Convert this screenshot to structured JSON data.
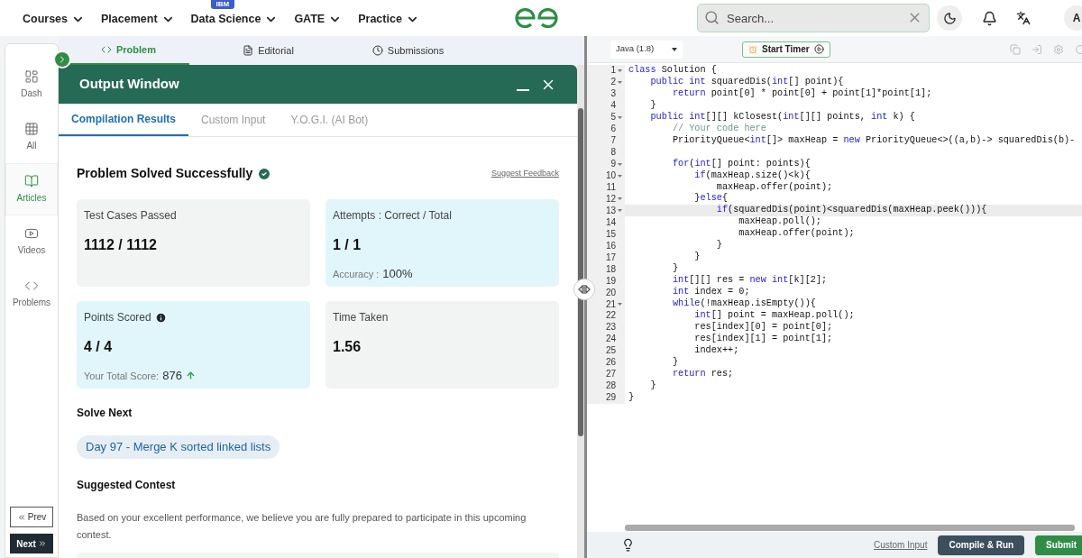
{
  "top_nav": {
    "items": [
      {
        "label": "Courses"
      },
      {
        "label": "Placement"
      },
      {
        "label": "Data Science",
        "badge": "IBM"
      },
      {
        "label": "GATE"
      },
      {
        "label": "Practice"
      }
    ],
    "search": {
      "placeholder": "Search..."
    },
    "avatar": "A"
  },
  "sidebar": {
    "items": [
      {
        "label": "Dash",
        "selected": false
      },
      {
        "label": "All",
        "selected": false
      },
      {
        "label": "Articles",
        "selected": true
      },
      {
        "label": "Videos",
        "selected": false
      },
      {
        "label": "Problems",
        "selected": false
      }
    ],
    "prev": "Prev",
    "next": "Next"
  },
  "problem_tabs": [
    {
      "label": "Problem",
      "selected": true
    },
    {
      "label": "Editorial",
      "selected": false
    },
    {
      "label": "Submissions",
      "selected": false
    }
  ],
  "output_window": {
    "title": "Output Window",
    "tabs": [
      {
        "label": "Compilation Results",
        "selected": true
      },
      {
        "label": "Custom Input",
        "selected": false
      },
      {
        "label": "Y.O.G.I. (AI Bot)",
        "selected": false
      }
    ],
    "heading": "Problem Solved Successfully",
    "feedback_link": "Suggest Feedback",
    "cards": [
      {
        "label": "Test Cases Passed",
        "value": "1112 / 1112",
        "highlighted": false,
        "info_icon": false
      },
      {
        "label": "Attempts : Correct / Total",
        "value": "1 / 1",
        "highlighted": true,
        "info_icon": false,
        "note_label": "Accuracy :",
        "note_value": "100%",
        "rising": false
      },
      {
        "label": "Points Scored",
        "value": "4 / 4",
        "highlighted": true,
        "info_icon": true,
        "note_label": "Your Total Score:",
        "note_value": "876",
        "rising": true
      },
      {
        "label": "Time Taken",
        "value": "1.56",
        "highlighted": false,
        "info_icon": false
      }
    ],
    "solve_next": {
      "title": "Solve Next",
      "problem": "Day 97 - Merge K sorted linked lists"
    },
    "suggested_contest": {
      "title": "Suggested Contest",
      "text": "Based on your excellent performance, we believe you are fully prepared to participate in this upcoming contest."
    }
  },
  "editor": {
    "language": "Java (1.8)",
    "timer_button": "Start Timer",
    "lines": [
      {
        "number": "1",
        "foldable": true,
        "active": false,
        "code": [
          {
            "kind": "keyword",
            "text": "class"
          },
          {
            "kind": "plain",
            "text": " Solution {"
          }
        ]
      },
      {
        "number": "2",
        "foldable": true,
        "active": false,
        "code": [
          {
            "kind": "keyword",
            "text": "    public"
          },
          {
            "kind": "keyword",
            "text": " int"
          },
          {
            "kind": "plain",
            "text": " squaredDis("
          },
          {
            "kind": "keyword",
            "text": "int"
          },
          {
            "kind": "plain",
            "text": "[] point){"
          }
        ]
      },
      {
        "number": "3",
        "foldable": false,
        "active": false,
        "code": [
          {
            "kind": "keyword",
            "text": "        return"
          },
          {
            "kind": "plain",
            "text": " point[0] * point[0] + point[1]*point[1];"
          }
        ]
      },
      {
        "number": "4",
        "foldable": false,
        "active": false,
        "code": [
          {
            "kind": "plain",
            "text": "    }"
          }
        ]
      },
      {
        "number": "5",
        "foldable": true,
        "active": false,
        "code": [
          {
            "kind": "keyword",
            "text": "    public"
          },
          {
            "kind": "keyword",
            "text": " int"
          },
          {
            "kind": "plain",
            "text": "[][] kClosest("
          },
          {
            "kind": "keyword",
            "text": "int"
          },
          {
            "kind": "plain",
            "text": "[][] points,"
          },
          {
            "kind": "keyword",
            "text": " int"
          },
          {
            "kind": "plain",
            "text": " k) {"
          }
        ]
      },
      {
        "number": "6",
        "foldable": false,
        "active": false,
        "code": [
          {
            "kind": "comment",
            "text": "        // Your code here"
          }
        ]
      },
      {
        "number": "7",
        "foldable": false,
        "active": false,
        "code": [
          {
            "kind": "plain",
            "text": "        PriorityQueue<"
          },
          {
            "kind": "keyword",
            "text": "int"
          },
          {
            "kind": "plain",
            "text": "[]> maxHeap ="
          },
          {
            "kind": "keyword",
            "text": " new"
          },
          {
            "kind": "plain",
            "text": " PriorityQueue<>((a,b)-> squaredDis(b)-"
          }
        ]
      },
      {
        "number": "8",
        "foldable": false,
        "active": false
      },
      {
        "number": "9",
        "foldable": true,
        "active": false,
        "code": [
          {
            "kind": "keyword",
            "text": "        for"
          },
          {
            "kind": "plain",
            "text": "("
          },
          {
            "kind": "keyword",
            "text": "int"
          },
          {
            "kind": "plain",
            "text": "[] point: points){"
          }
        ]
      },
      {
        "number": "10",
        "foldable": true,
        "active": false,
        "code": [
          {
            "kind": "keyword",
            "text": "            if"
          },
          {
            "kind": "plain",
            "text": "(maxHeap.size()<k){"
          }
        ]
      },
      {
        "number": "11",
        "foldable": false,
        "active": false,
        "code": [
          {
            "kind": "plain",
            "text": "                maxHeap.offer(point);"
          }
        ]
      },
      {
        "number": "12",
        "foldable": true,
        "active": false,
        "code": [
          {
            "kind": "plain",
            "text": "            }"
          },
          {
            "kind": "keyword",
            "text": "else"
          },
          {
            "kind": "plain",
            "text": "{"
          }
        ]
      },
      {
        "number": "13",
        "foldable": true,
        "active": true,
        "code": [
          {
            "kind": "keyword",
            "text": "                if"
          },
          {
            "kind": "plain",
            "text": "(squaredDis(point)<squaredDis(maxHeap.peek())){"
          }
        ]
      },
      {
        "number": "14",
        "foldable": false,
        "active": false,
        "code": [
          {
            "kind": "plain",
            "text": "                    maxHeap.poll();"
          }
        ]
      },
      {
        "number": "15",
        "foldable": false,
        "active": false,
        "code": [
          {
            "kind": "plain",
            "text": "                    maxHeap.offer(point);"
          }
        ]
      },
      {
        "number": "16",
        "foldable": false,
        "active": false,
        "code": [
          {
            "kind": "plain",
            "text": "                }"
          }
        ]
      },
      {
        "number": "17",
        "foldable": false,
        "active": false,
        "code": [
          {
            "kind": "plain",
            "text": "            }"
          }
        ]
      },
      {
        "number": "18",
        "foldable": false,
        "active": false,
        "code": [
          {
            "kind": "plain",
            "text": "        }"
          }
        ]
      },
      {
        "number": "19",
        "foldable": false,
        "active": false,
        "code": [
          {
            "kind": "keyword",
            "text": "        int"
          },
          {
            "kind": "plain",
            "text": "[][] res ="
          },
          {
            "kind": "keyword",
            "text": " new int"
          },
          {
            "kind": "plain",
            "text": "[k][2];"
          }
        ]
      },
      {
        "number": "20",
        "foldable": false,
        "active": false,
        "code": [
          {
            "kind": "keyword",
            "text": "        int"
          },
          {
            "kind": "plain",
            "text": " index = 0;"
          }
        ]
      },
      {
        "number": "21",
        "foldable": true,
        "active": false,
        "code": [
          {
            "kind": "keyword",
            "text": "        while"
          },
          {
            "kind": "plain",
            "text": "(!maxHeap.isEmpty()){"
          }
        ]
      },
      {
        "number": "22",
        "foldable": false,
        "active": false,
        "code": [
          {
            "kind": "keyword",
            "text": "            int"
          },
          {
            "kind": "plain",
            "text": "[] point = maxHeap.poll();"
          }
        ]
      },
      {
        "number": "23",
        "foldable": false,
        "active": false,
        "code": [
          {
            "kind": "plain",
            "text": "            res[index][0] = point[0];"
          }
        ]
      },
      {
        "number": "24",
        "foldable": false,
        "active": false,
        "code": [
          {
            "kind": "plain",
            "text": "            res[index][1] = point[1];"
          }
        ]
      },
      {
        "number": "25",
        "foldable": false,
        "active": false,
        "code": [
          {
            "kind": "plain",
            "text": "            index++;"
          }
        ]
      },
      {
        "number": "26",
        "foldable": false,
        "active": false,
        "code": [
          {
            "kind": "plain",
            "text": "        }"
          }
        ]
      },
      {
        "number": "27",
        "foldable": false,
        "active": false,
        "code": [
          {
            "kind": "keyword",
            "text": "        return"
          },
          {
            "kind": "plain",
            "text": " res;"
          }
        ]
      },
      {
        "number": "28",
        "foldable": false,
        "active": false,
        "code": [
          {
            "kind": "plain",
            "text": "    }"
          }
        ]
      },
      {
        "number": "29",
        "foldable": false,
        "active": false,
        "code": [
          {
            "kind": "plain",
            "text": "}"
          }
        ]
      }
    ],
    "custom_input_link": "Custom Input",
    "compile_button": "Compile & Run",
    "submit_button": "Submit"
  }
}
